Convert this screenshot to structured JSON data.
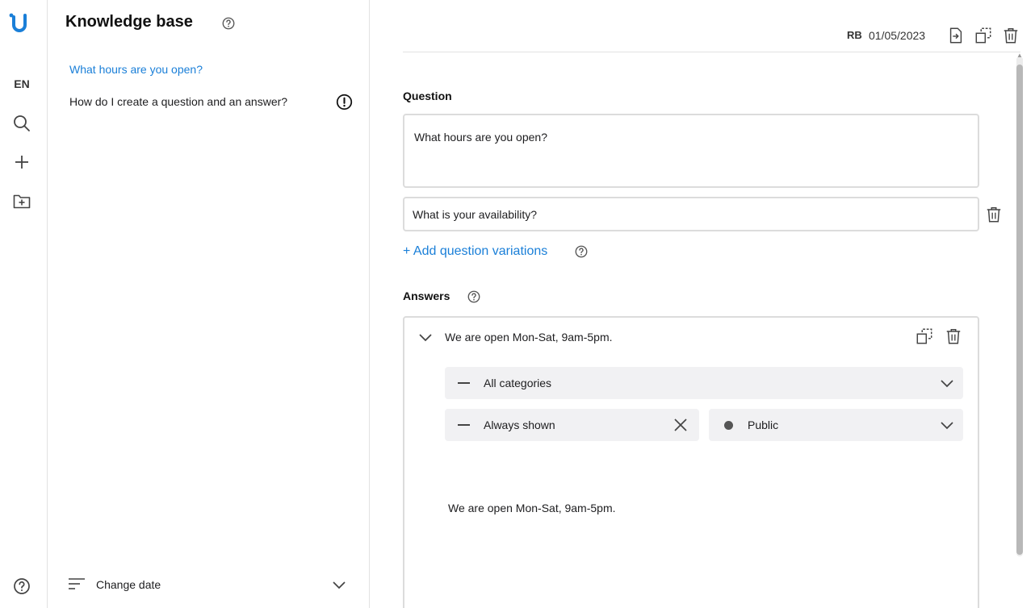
{
  "rail": {
    "language": "EN"
  },
  "kb": {
    "title": "Knowledge base",
    "items": [
      {
        "label": "What hours are you open?"
      },
      {
        "label": "How do I create a question and an answer?"
      }
    ],
    "footer_label": "Change date"
  },
  "topbar": {
    "initials": "RB",
    "date": "01/05/2023"
  },
  "question": {
    "label": "Question",
    "value": "What hours are you open?",
    "variations": [
      "What is your availability?"
    ],
    "add_variation_label": "+ Add question variations"
  },
  "answers": {
    "label": "Answers",
    "items": [
      {
        "title": "We are open Mon-Sat, 9am-5pm.",
        "category": "All categories",
        "visibility_rule": "Always shown",
        "audience": "Public",
        "body": "We are open Mon-Sat, 9am-5pm."
      }
    ]
  },
  "colors": {
    "accent": "#1a7fd8",
    "border": "#dcdcdc",
    "pill_bg": "#f1f1f3"
  },
  "icons": {
    "logo": "u-logo-icon",
    "search": "search-icon",
    "add": "plus-icon",
    "folder_add": "folder-plus-icon",
    "help": "help-circle-icon",
    "warning": "alert-circle-icon",
    "sort": "sort-lines-icon",
    "export": "file-export-icon",
    "duplicate": "duplicate-icon",
    "delete": "trash-icon",
    "chevron": "chevron-down-icon",
    "clear": "close-icon"
  }
}
